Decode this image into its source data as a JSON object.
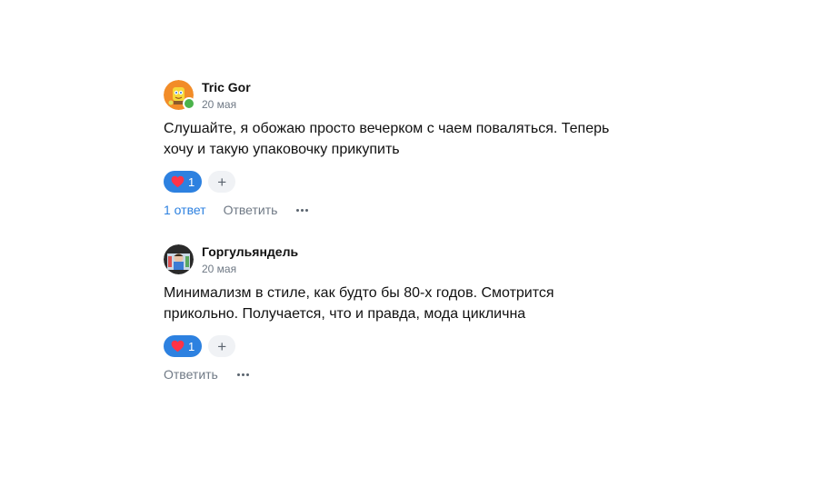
{
  "comments": [
    {
      "author": "Tric Gor",
      "date": "20 мая",
      "text": "Слушайте, я обожаю просто вечерком с чаем поваляться. Теперь хочу и такую упаковочку прикупить",
      "reaction_count": "1",
      "add_reaction_label": "+",
      "replies_label": "1 ответ",
      "reply_label": "Ответить",
      "online": true,
      "avatar_color": "#f28c28"
    },
    {
      "author": "Горгульяндель",
      "date": "20 мая",
      "text": "Минимализм в стиле, как будто бы 80-х годов. Смотрится прикольно. Получается, что и правда, мода циклична",
      "reaction_count": "1",
      "add_reaction_label": "+",
      "reply_label": "Ответить",
      "online": false,
      "avatar_color": "#2a2a2a"
    }
  ],
  "colors": {
    "accent": "#2d81e0",
    "heart": "#ff3347",
    "online": "#4bb34b",
    "secondary_text": "#6f7985"
  }
}
